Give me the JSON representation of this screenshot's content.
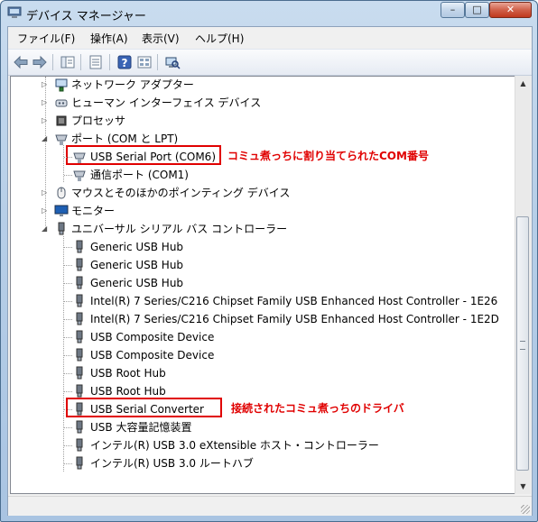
{
  "window": {
    "title": "デバイス マネージャー",
    "controls": {
      "minimize": "–",
      "maximize": "□",
      "close": "✕"
    }
  },
  "menu": [
    "ファイル(F)",
    "操作(A)",
    "表示(V)",
    "ヘルプ(H)"
  ],
  "toolbar": {
    "icons": [
      "back-icon",
      "forward-icon",
      "show-hide-console-tree-icon",
      "properties-icon",
      "help-icon",
      "view-icon",
      "scan-hardware-icon"
    ]
  },
  "tree": {
    "categories_top": [
      {
        "label": "ネットワーク アダプター",
        "icon": "network-adapter-icon"
      },
      {
        "label": "ヒューマン インターフェイス デバイス",
        "icon": "hid-icon"
      },
      {
        "label": "プロセッサ",
        "icon": "processor-icon"
      }
    ],
    "ports": {
      "label": "ポート (COM と LPT)",
      "children": [
        "USB Serial Port (COM6)",
        "通信ポート (COM1)"
      ]
    },
    "categories_mid": [
      {
        "label": "マウスとそのほかのポインティング デバイス",
        "icon": "mouse-icon"
      },
      {
        "label": "モニター",
        "icon": "monitor-icon"
      }
    ],
    "usb": {
      "label": "ユニバーサル シリアル バス コントローラー",
      "children": [
        "Generic USB Hub",
        "Generic USB Hub",
        "Generic USB Hub",
        "Intel(R) 7 Series/C216 Chipset Family USB Enhanced Host Controller - 1E26",
        "Intel(R) 7 Series/C216 Chipset Family USB Enhanced Host Controller - 1E2D",
        "USB Composite Device",
        "USB Composite Device",
        "USB Root Hub",
        "USB Root Hub",
        "USB Serial Converter",
        "USB 大容量記憶装置",
        "インテル(R) USB 3.0 eXtensible ホスト・コントローラー",
        "インテル(R) USB 3.0 ルートハブ"
      ]
    }
  },
  "annotations": {
    "com_port": "コミュ煮っちに割り当てられたCOM番号",
    "driver": "接続されたコミュ煮っちのドライバ"
  },
  "colors": {
    "highlight": "#e00000",
    "title_bar": "#b7cfe8"
  }
}
